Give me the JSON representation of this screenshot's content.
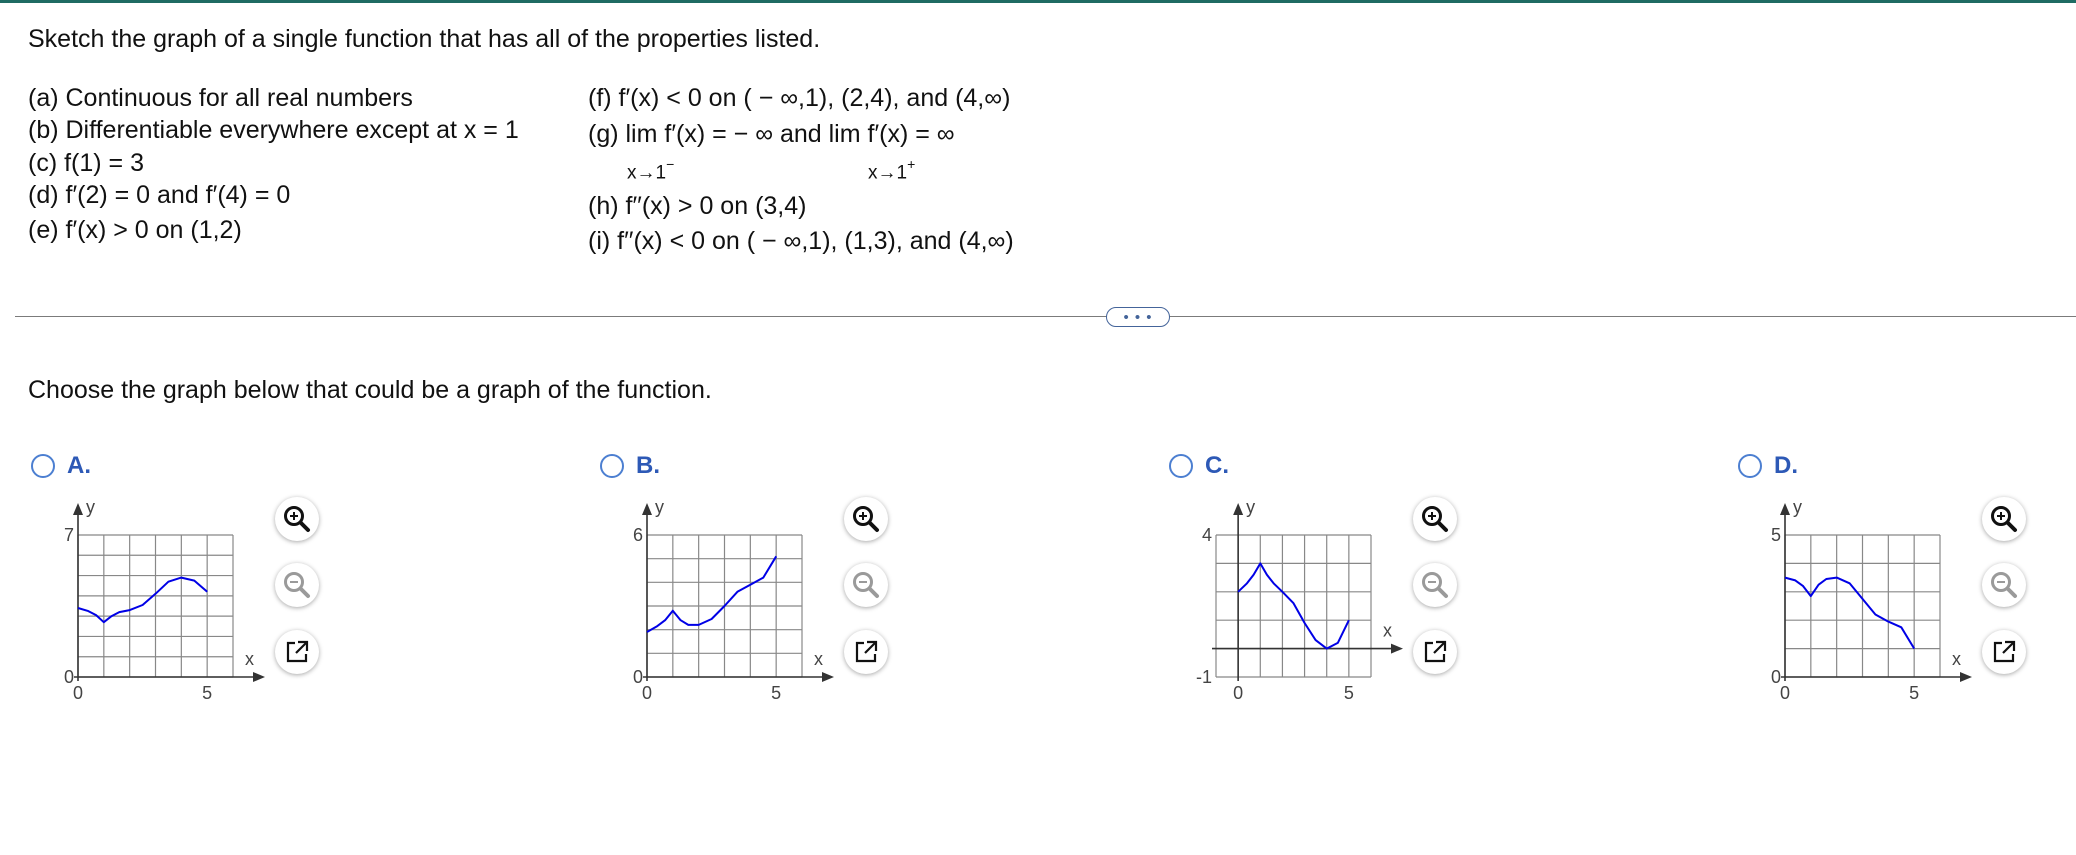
{
  "question": {
    "prompt": "Sketch the graph of a single function that has all of the properties listed.",
    "properties_left": [
      "(a) Continuous for all real numbers",
      "(b) Differentiable everywhere except at x = 1",
      "(c) f(1) = 3",
      "(d) f′(2) = 0 and f′(4) = 0",
      "(e) f′(x) > 0 on (1,2)"
    ],
    "properties_right": {
      "f": "(f) f′(x) < 0 on ( − ∞,1), (2,4), and (4,∞)",
      "g": "(g)  lim  f′(x) = − ∞ and  lim  f′(x) = ∞",
      "g_sub1": "x→1",
      "g_sub1_sup": "−",
      "g_sub2": "x→1",
      "g_sub2_sup": "+",
      "h": "(h) f′′(x) > 0 on (3,4)",
      "i": "(i) f′′(x) < 0 on ( − ∞,1), (1,3), and (4,∞)"
    }
  },
  "more_button": "• • •",
  "choose_prompt": "Choose the graph below that could be a graph of the function.",
  "colors": {
    "accent": "#2d59b6",
    "curve": "#0000e6",
    "grid": "#888888",
    "radio": "#4c7fd1"
  },
  "tool_icons": [
    "zoom-in-icon",
    "zoom-out-icon",
    "pop-out-icon"
  ],
  "options": [
    {
      "label": "A.",
      "chart_data": {
        "type": "line",
        "xlabel": "x",
        "ylabel": "y",
        "xlim": [
          0,
          6
        ],
        "ylim": [
          0,
          7
        ],
        "grid": true,
        "xticks": [
          "0",
          "5"
        ],
        "yticks": [
          "0",
          "7"
        ],
        "curve": [
          [
            0,
            3.4
          ],
          [
            0.4,
            3.25
          ],
          [
            0.7,
            3.05
          ],
          [
            1,
            2.7
          ],
          [
            1.3,
            3.0
          ],
          [
            1.6,
            3.2
          ],
          [
            2,
            3.3
          ],
          [
            2.5,
            3.55
          ],
          [
            3,
            4.1
          ],
          [
            3.5,
            4.7
          ],
          [
            4,
            4.9
          ],
          [
            4.5,
            4.75
          ],
          [
            5,
            4.2
          ]
        ]
      }
    },
    {
      "label": "B.",
      "chart_data": {
        "type": "line",
        "xlabel": "x",
        "ylabel": "y",
        "xlim": [
          0,
          6
        ],
        "ylim": [
          0,
          6
        ],
        "grid": true,
        "xticks": [
          "0",
          "5"
        ],
        "yticks": [
          "0",
          "6"
        ],
        "curve": [
          [
            0,
            1.9
          ],
          [
            0.4,
            2.15
          ],
          [
            0.7,
            2.4
          ],
          [
            1,
            2.8
          ],
          [
            1.3,
            2.4
          ],
          [
            1.6,
            2.2
          ],
          [
            2,
            2.2
          ],
          [
            2.5,
            2.45
          ],
          [
            3,
            3.0
          ],
          [
            3.5,
            3.6
          ],
          [
            4,
            3.9
          ],
          [
            4.5,
            4.2
          ],
          [
            5,
            5.1
          ]
        ]
      }
    },
    {
      "label": "C.",
      "chart_data": {
        "type": "line",
        "xlabel": "x",
        "ylabel": "y",
        "xlim": [
          -1,
          6
        ],
        "ylim": [
          -1,
          4
        ],
        "grid": true,
        "xticks": [
          "0",
          "5"
        ],
        "yticks": [
          "-1",
          "4"
        ],
        "curve": [
          [
            0,
            2
          ],
          [
            0.4,
            2.3
          ],
          [
            0.7,
            2.6
          ],
          [
            1,
            3
          ],
          [
            1.3,
            2.6
          ],
          [
            1.6,
            2.3
          ],
          [
            2,
            2
          ],
          [
            2.5,
            1.6
          ],
          [
            3,
            0.9
          ],
          [
            3.5,
            0.3
          ],
          [
            4,
            0
          ],
          [
            4.5,
            0.2
          ],
          [
            5,
            1
          ]
        ]
      }
    },
    {
      "label": "D.",
      "chart_data": {
        "type": "line",
        "xlabel": "x",
        "ylabel": "y",
        "xlim": [
          0,
          6
        ],
        "ylim": [
          0,
          5
        ],
        "grid": true,
        "xticks": [
          "0",
          "5"
        ],
        "yticks": [
          "0",
          "5"
        ],
        "curve": [
          [
            0,
            3.5
          ],
          [
            0.4,
            3.4
          ],
          [
            0.7,
            3.2
          ],
          [
            1,
            2.85
          ],
          [
            1.3,
            3.25
          ],
          [
            1.6,
            3.45
          ],
          [
            2,
            3.5
          ],
          [
            2.5,
            3.3
          ],
          [
            3,
            2.75
          ],
          [
            3.5,
            2.2
          ],
          [
            4,
            1.95
          ],
          [
            4.5,
            1.75
          ],
          [
            5,
            1.0
          ]
        ]
      }
    }
  ]
}
